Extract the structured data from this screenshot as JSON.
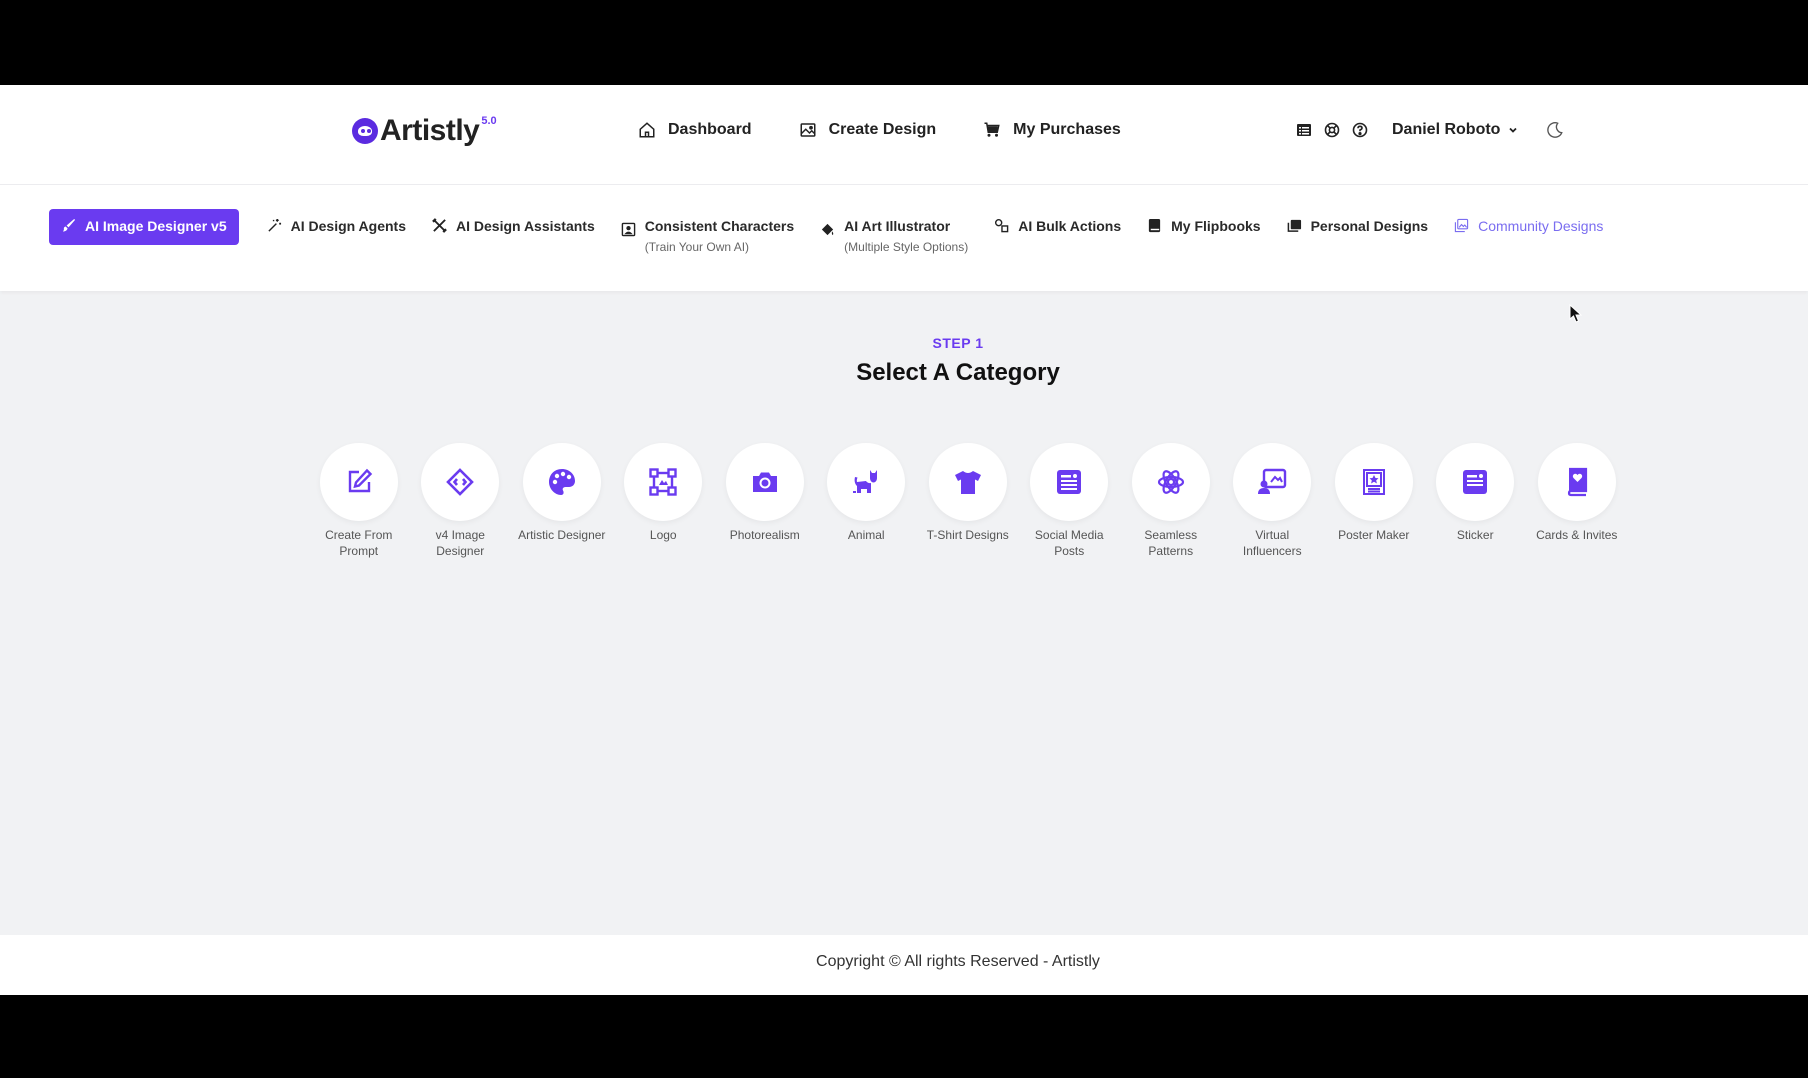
{
  "brand": {
    "name": "Artistly",
    "version": "5.0",
    "accent": "#6a3bf0"
  },
  "topnav": [
    {
      "label": "Dashboard",
      "icon": "home-icon"
    },
    {
      "label": "Create Design",
      "icon": "image-icon"
    },
    {
      "label": "My Purchases",
      "icon": "cart-icon"
    }
  ],
  "header_right": {
    "icons": [
      "list-icon",
      "help-ring-icon",
      "question-icon"
    ],
    "user_name": "Daniel Roboto",
    "theme_icon": "moon-icon"
  },
  "subnav": [
    {
      "label": "AI Image Designer v5",
      "sub": "",
      "icon": "brush-icon",
      "active": true
    },
    {
      "label": "AI Design Agents",
      "sub": "",
      "icon": "wand-icon"
    },
    {
      "label": "AI Design Assistants",
      "sub": "",
      "icon": "tools-icon"
    },
    {
      "label": "Consistent Characters",
      "sub": "(Train Your Own AI)",
      "icon": "portrait-icon"
    },
    {
      "label": "AI Art Illustrator",
      "sub": "(Multiple Style Options)",
      "icon": "fill-icon"
    },
    {
      "label": "AI Bulk Actions",
      "sub": "",
      "icon": "shapes-icon"
    },
    {
      "label": "My Flipbooks",
      "sub": "",
      "icon": "book-icon"
    },
    {
      "label": "Personal Designs",
      "sub": "",
      "icon": "images-icon"
    },
    {
      "label": "Community Designs",
      "sub": "",
      "icon": "gallery-icon"
    }
  ],
  "step": {
    "label": "STEP 1",
    "title": "Select A Category"
  },
  "categories": [
    {
      "label": "Create From Prompt",
      "icon": "edit-icon"
    },
    {
      "label": "v4 Image Designer",
      "icon": "diamond-code-icon"
    },
    {
      "label": "Artistic Designer",
      "icon": "palette-icon"
    },
    {
      "label": "Logo",
      "icon": "vector-square-icon"
    },
    {
      "label": "Photorealism",
      "icon": "camera-icon"
    },
    {
      "label": "Animal",
      "icon": "cat-icon"
    },
    {
      "label": "T-Shirt Designs",
      "icon": "tshirt-icon"
    },
    {
      "label": "Social Media Posts",
      "icon": "post-card-icon"
    },
    {
      "label": "Seamless Patterns",
      "icon": "atom-pattern-icon"
    },
    {
      "label": "Virtual Influencers",
      "icon": "presenter-icon"
    },
    {
      "label": "Poster Maker",
      "icon": "poster-icon"
    },
    {
      "label": "Sticker",
      "icon": "sticker-icon"
    },
    {
      "label": "Cards & Invites",
      "icon": "card-heart-icon"
    }
  ],
  "footer": {
    "copyright": "Copyright © All rights Reserved - Artistly"
  }
}
